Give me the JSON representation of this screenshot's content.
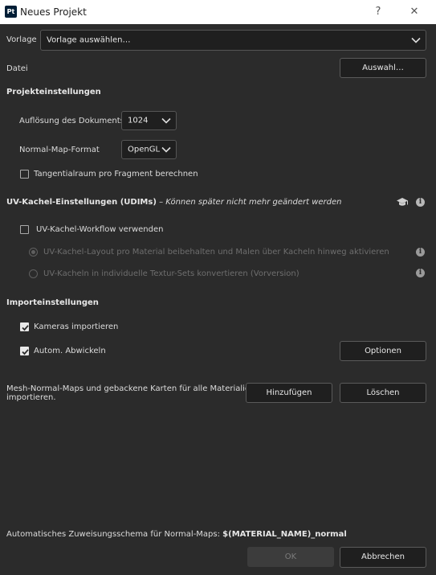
{
  "window": {
    "app_badge": "Pt",
    "title": "Neues Projekt",
    "help": "?",
    "close": "✕"
  },
  "template": {
    "label": "Vorlage",
    "value": "Vorlage auswählen…"
  },
  "file": {
    "label": "Datei",
    "button": "Auswahl…"
  },
  "project_settings": {
    "heading": "Projekteinstellungen",
    "resolution_label": "Auflösung des Dokuments",
    "resolution_value": "1024",
    "normal_map_label": "Normal-Map-Format",
    "normal_map_value": "OpenGL",
    "tangent_label": "Tangentialraum pro Fragment berechnen",
    "tangent_checked": false
  },
  "uv_tiles": {
    "heading": "UV-Kachel-Einstellungen (UDIMs)",
    "heading_suffix": " – ",
    "note": "Können später nicht mehr geändert werden",
    "workflow_label": "UV-Kachel-Workflow verwenden",
    "workflow_checked": false,
    "option1": "UV-Kachel-Layout pro Material beibehalten und Malen über Kacheln hinweg aktivieren",
    "option2": "UV-Kacheln in individuelle Textur-Sets konvertieren (Vorversion)",
    "selected_option": 1
  },
  "import_settings": {
    "heading": "Importeinstellungen",
    "cameras_label": "Kameras importieren",
    "cameras_checked": true,
    "unwrap_label": "Autom. Abwickeln",
    "unwrap_checked": true,
    "options_button": "Optionen"
  },
  "mesh_maps": {
    "text_line1": "Mesh-Normal-Maps und gebackene Karten für alle Materialien",
    "text_line2": "importieren.",
    "add_button": "Hinzufügen",
    "delete_button": "Löschen"
  },
  "footer": {
    "schema_label": "Automatisches Zuweisungsschema für Normal-Maps:",
    "schema_value": "$(MATERIAL_NAME)_normal",
    "ok_button": "OK",
    "ok_enabled": false,
    "cancel_button": "Abbrechen"
  }
}
